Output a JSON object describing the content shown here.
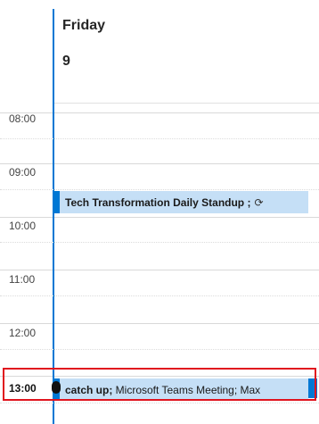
{
  "day": {
    "name": "Friday",
    "number": "9"
  },
  "time_slots": [
    "08:00",
    "09:00",
    "10:00",
    "11:00",
    "12:00",
    "13:00"
  ],
  "current_time_slot": "13:00",
  "events": [
    {
      "title": "Tech Transformation Daily Standup ;",
      "rest": "",
      "recurring": true,
      "icon": "recurring-icon"
    },
    {
      "title": "catch up;",
      "rest": " Microsoft Teams Meeting; Max",
      "recurring": false
    }
  ],
  "colors": {
    "accent": "#0078d4",
    "event_fill": "#c5dff6",
    "highlight": "#e0141e"
  }
}
